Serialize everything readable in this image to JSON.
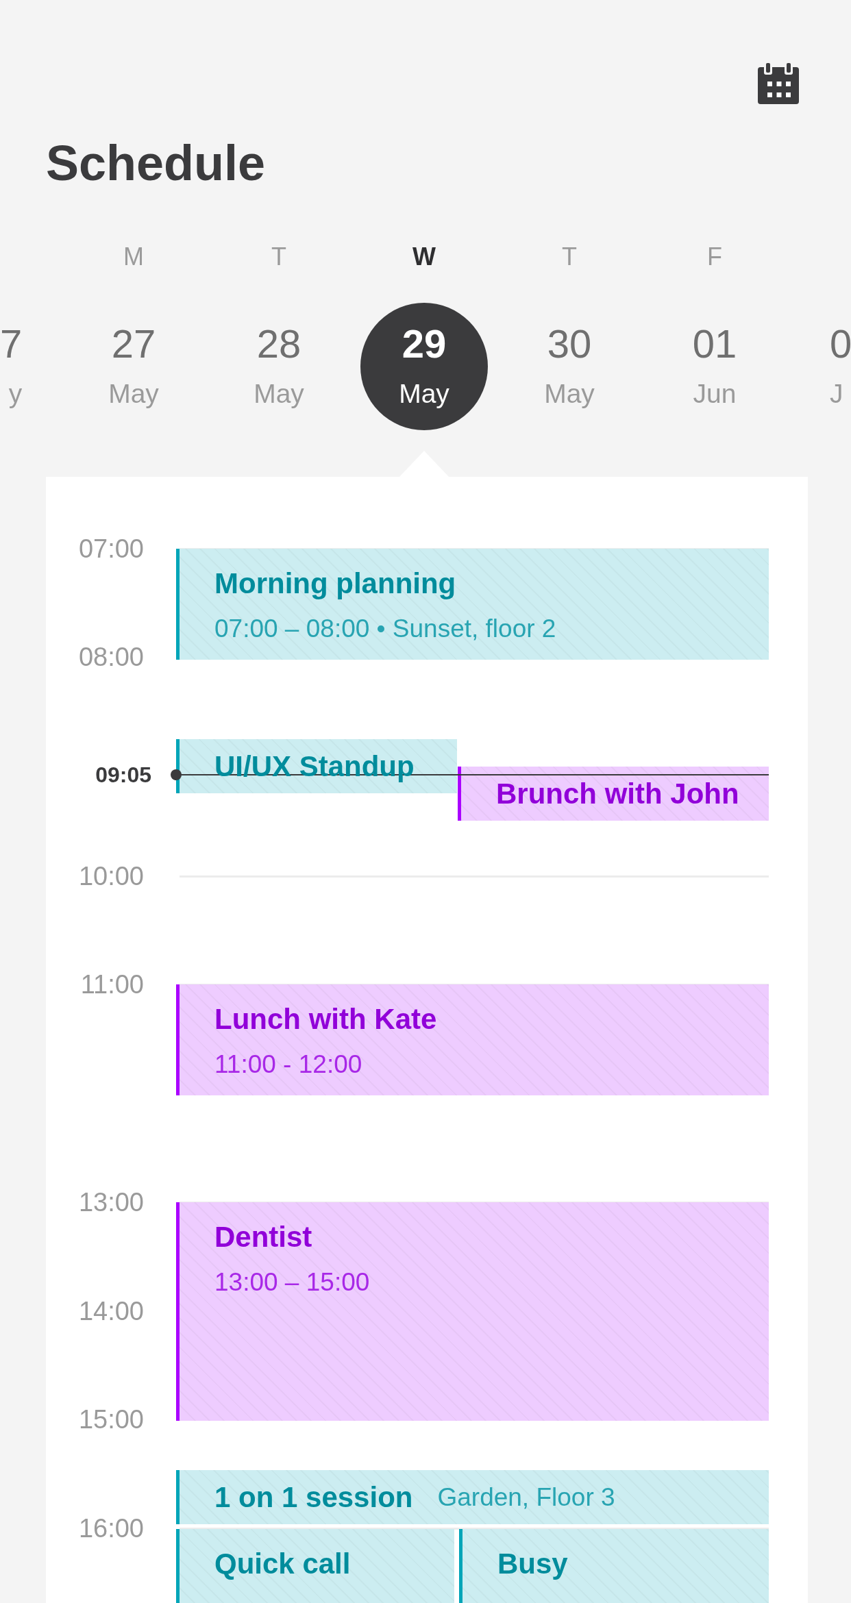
{
  "header": {
    "title": "Schedule"
  },
  "week": {
    "days": [
      {
        "date": "7",
        "month": "y",
        "selected": false
      },
      {
        "weekday": "M",
        "date": "27",
        "month": "May",
        "selected": false
      },
      {
        "weekday": "T",
        "date": "28",
        "month": "May",
        "selected": false
      },
      {
        "weekday": "W",
        "date": "29",
        "month": "May",
        "selected": true
      },
      {
        "weekday": "T",
        "date": "30",
        "month": "May",
        "selected": false
      },
      {
        "weekday": "F",
        "date": "01",
        "month": "Jun",
        "selected": false
      },
      {
        "date": "0",
        "month": "J",
        "selected": false
      }
    ]
  },
  "schedule": {
    "hours": [
      "07:00",
      "08:00",
      "10:00",
      "11:00",
      "13:00",
      "14:00",
      "15:00",
      "16:00"
    ],
    "current_time": "09:05",
    "events": [
      {
        "title": "Morning planning",
        "details": "07:00 – 08:00 • Sunset, floor 2",
        "color": "#00a5b8"
      },
      {
        "title": "UI/UX Standup",
        "color": "#00a5b8"
      },
      {
        "title": "Brunch with John",
        "color": "#aa00ff"
      },
      {
        "title": "Lunch with Kate",
        "details": "11:00 - 12:00",
        "color": "#aa00ff"
      },
      {
        "title": "Dentist",
        "details": "13:00 – 15:00",
        "color": "#aa00ff"
      },
      {
        "title": "1 on 1 session",
        "details": "Garden, Floor 3",
        "color": "#00a5b8"
      },
      {
        "title": "Quick call",
        "color": "#00a5b8"
      },
      {
        "title": "Busy",
        "color": "#00a5b8"
      }
    ]
  }
}
